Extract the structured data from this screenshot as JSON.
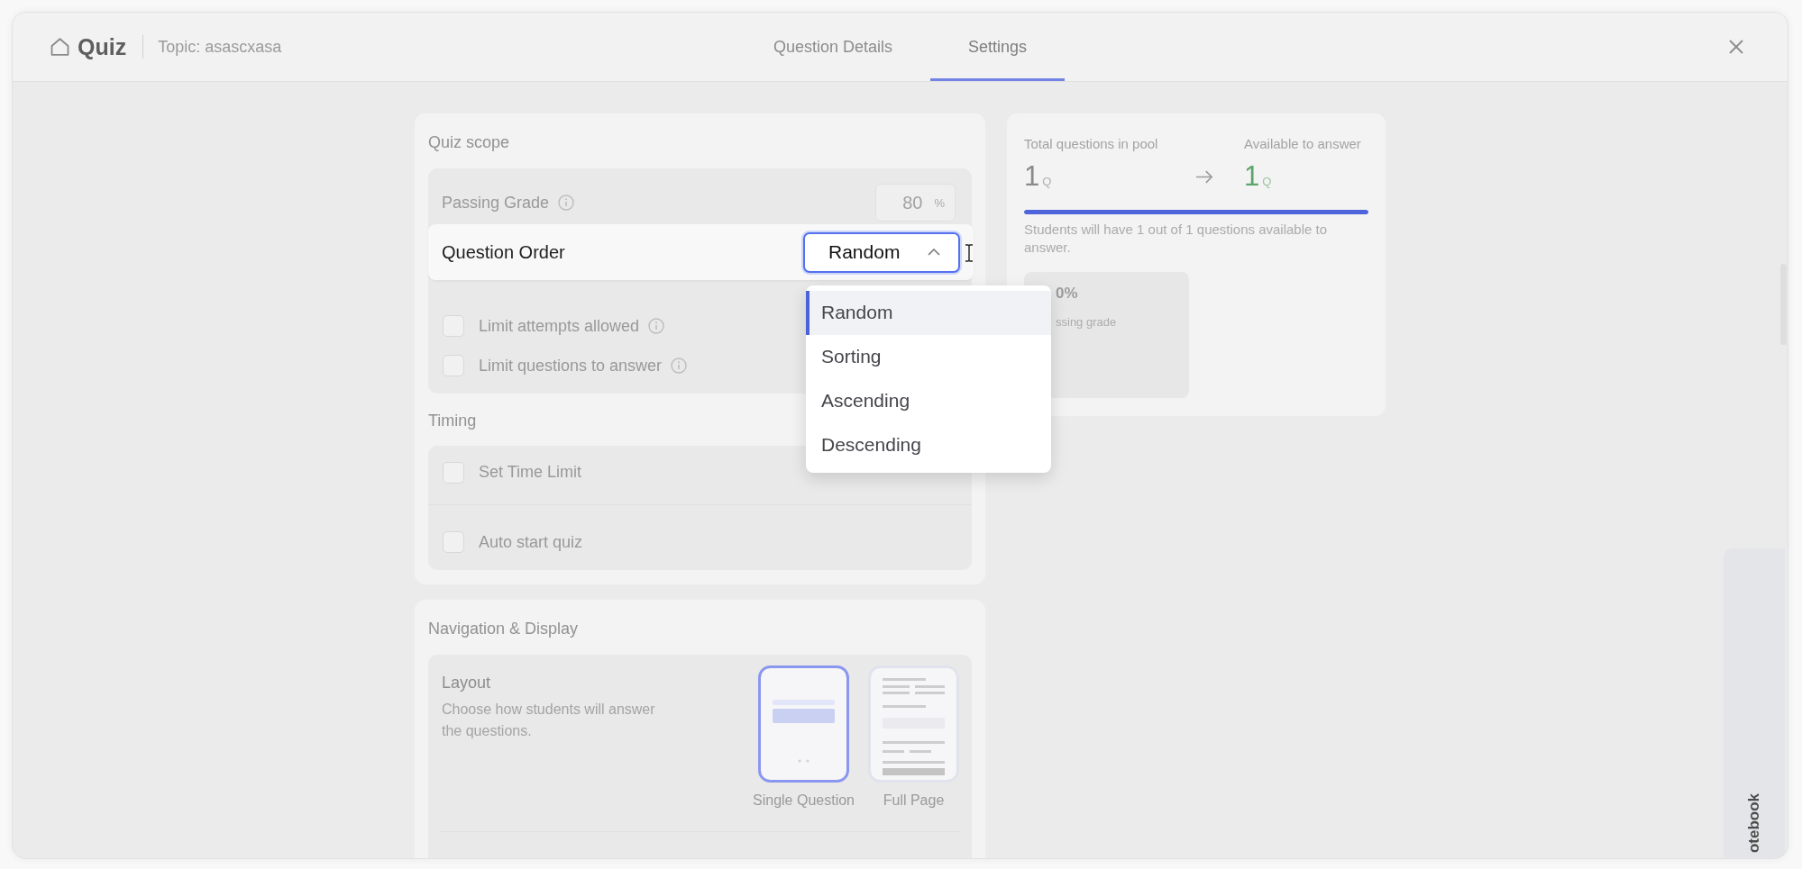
{
  "window": {
    "title": "Quiz",
    "topic": "Topic: asascxasa"
  },
  "tabs": [
    {
      "label": "Question Details",
      "selected": false
    },
    {
      "label": "Settings",
      "selected": true
    }
  ],
  "quiz_scope": {
    "title": "Quiz scope",
    "passing_grade": {
      "label": "Passing Grade",
      "info": true,
      "value": "80",
      "unit": "%"
    },
    "question_order": {
      "label": "Question Order",
      "value": "Random",
      "expanded": true,
      "options": [
        {
          "label": "Random",
          "selected": true
        },
        {
          "label": "Sorting",
          "selected": false
        },
        {
          "label": "Ascending",
          "selected": false
        },
        {
          "label": "Descending",
          "selected": false
        }
      ]
    },
    "limits": [
      {
        "label": "Limit attempts allowed",
        "checked": false,
        "info": true
      },
      {
        "label": "Limit questions to answer",
        "checked": false,
        "info": true
      }
    ]
  },
  "timing": {
    "title": "Timing",
    "options": [
      {
        "label": "Set Time Limit",
        "checked": false
      },
      {
        "label": "Auto start quiz",
        "checked": false
      }
    ]
  },
  "navigation": {
    "title": "Navigation & Display",
    "layout": {
      "title": "Layout",
      "description": "Choose how students will answer the questions.",
      "choices": [
        {
          "label": "Single Question",
          "kind": "single",
          "selected": true
        },
        {
          "label": "Full Page",
          "kind": "full",
          "selected": false
        }
      ]
    }
  },
  "summary": {
    "pool_label": "Total questions in pool",
    "pool_count": "1",
    "pool_unit": "Q",
    "available_label": "Available to answer",
    "available_count": "1",
    "available_unit": "Q",
    "level": 1,
    "note": "Students will have 1 out of 1 questions available to answer.",
    "grade_value": "0%",
    "grade_label": "ssing grade"
  },
  "side_tab": {
    "label": "otebook"
  }
}
